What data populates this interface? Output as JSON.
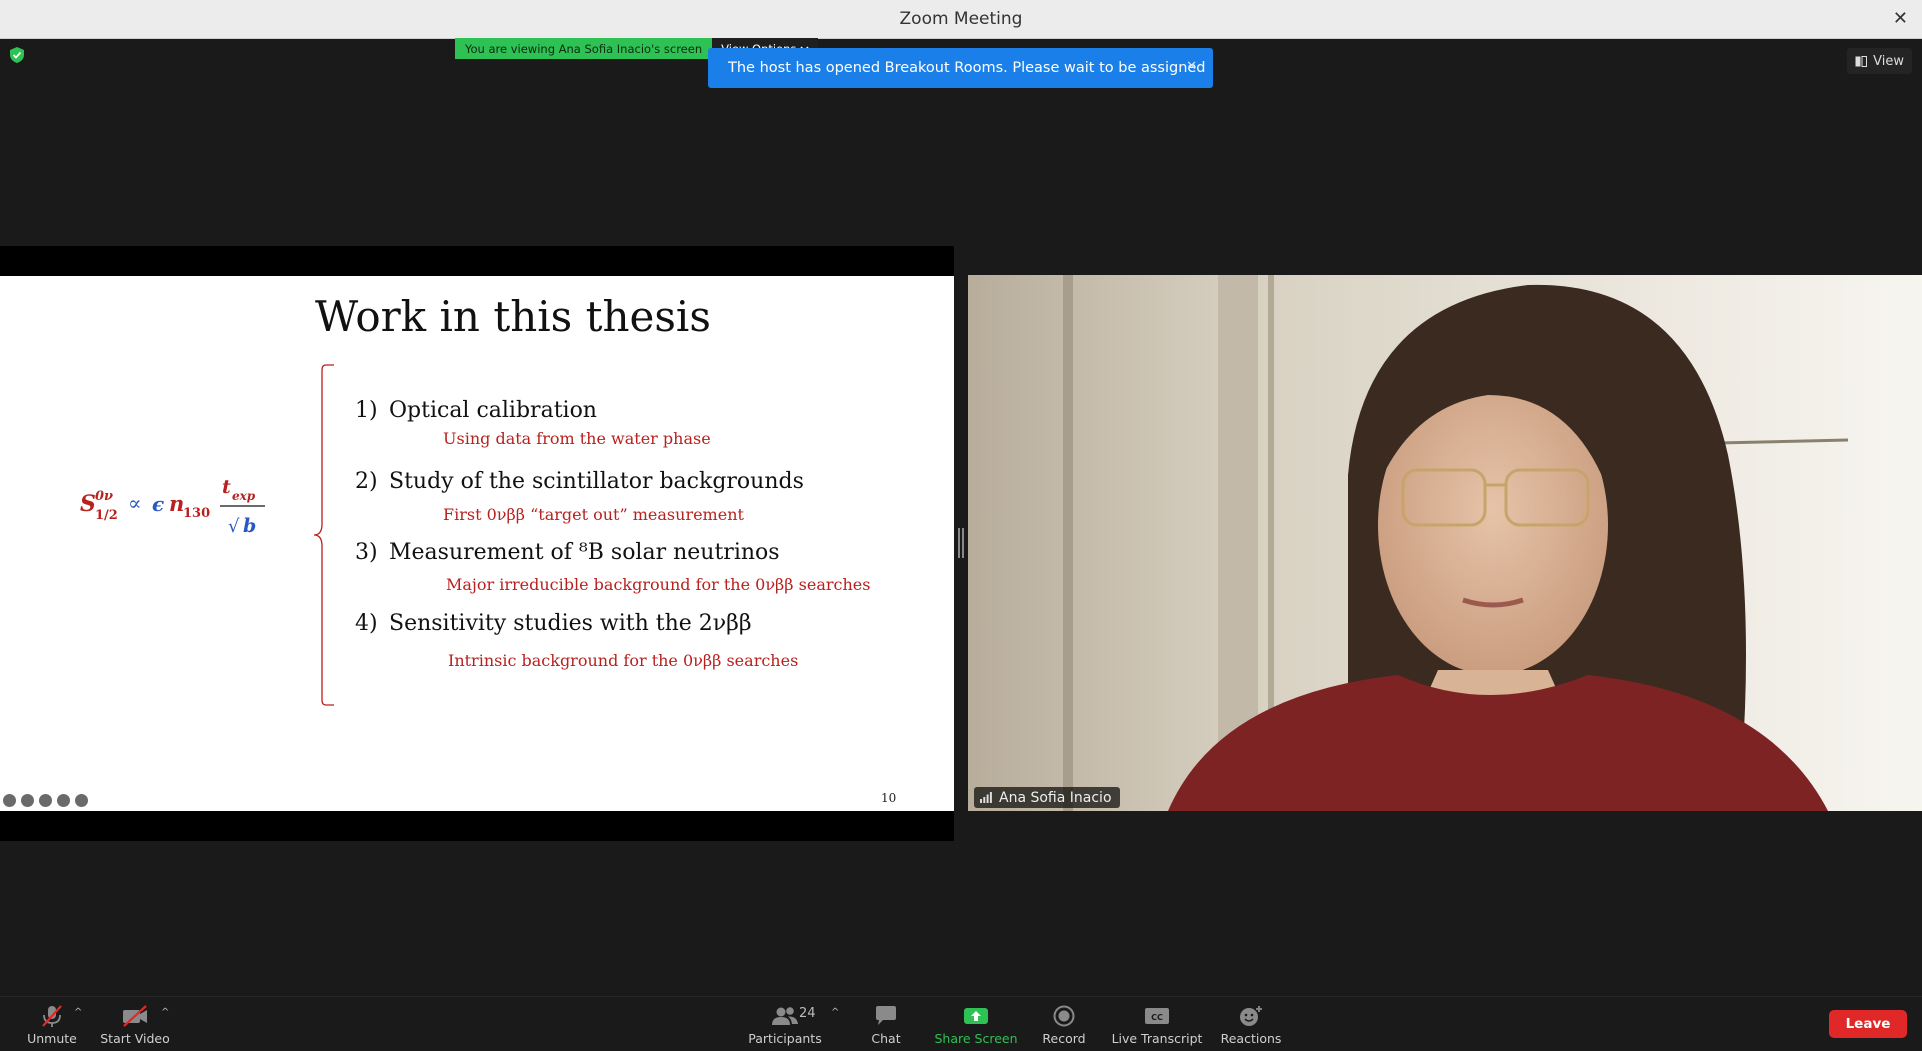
{
  "window": {
    "title": "Zoom Meeting",
    "close_symbol": "✕"
  },
  "banner": {
    "viewing_text": "You are viewing Ana Sofia Inacio's screen",
    "view_options_label": "View Options"
  },
  "notification": {
    "text": "The host has opened Breakout Rooms. Please wait to be assigned"
  },
  "view_button": {
    "label": "View"
  },
  "slide": {
    "title": "Work in this thesis",
    "items": [
      {
        "num": "1)",
        "text": "Optical calibration",
        "sub": "Using data from the water phase"
      },
      {
        "num": "2)",
        "text": "Study of the scintillator backgrounds",
        "sub": "First 0νββ “target out” measurement"
      },
      {
        "num": "3)",
        "text": "Measurement of ⁸B solar neutrinos",
        "sub": "Major irreducible background for the 0νββ searches"
      },
      {
        "num": "4)",
        "text": "Sensitivity studies with the 2νββ",
        "sub": "Intrinsic background for the 0νββ searches"
      }
    ],
    "page_number": "10"
  },
  "participant": {
    "name": "Ana Sofia Inacio"
  },
  "toolbar": {
    "unmute": "Unmute",
    "start_video": "Start Video",
    "participants": "Participants",
    "participant_count": "24",
    "chat": "Chat",
    "share_screen": "Share Screen",
    "record": "Record",
    "live_transcript": "Live Transcript",
    "reactions": "Reactions",
    "leave": "Leave"
  }
}
